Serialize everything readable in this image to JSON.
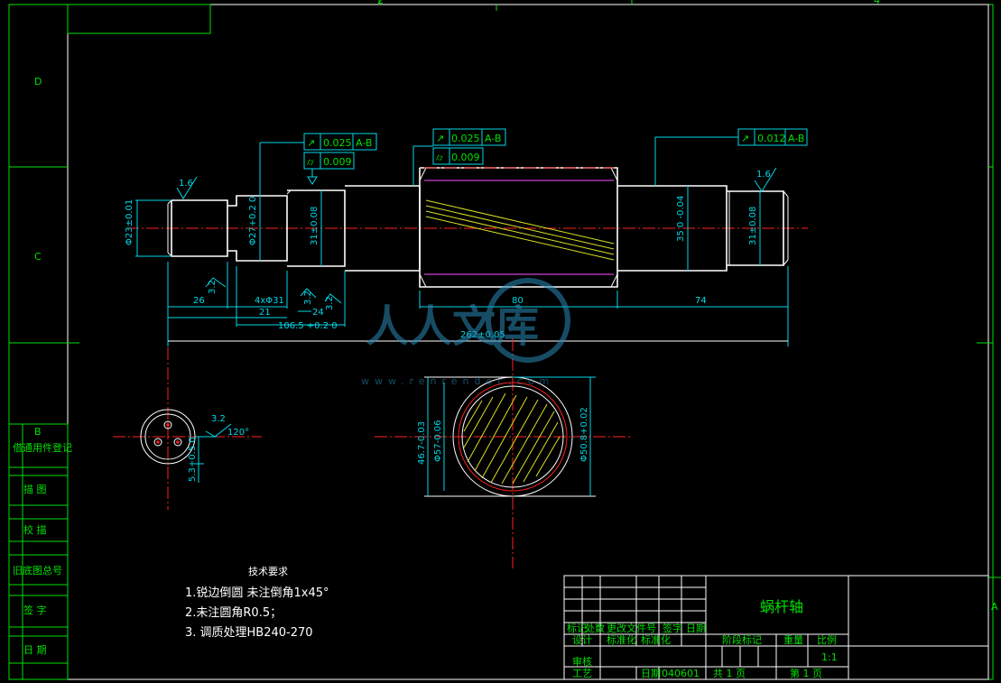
{
  "border": {
    "zone_letters": [
      "D",
      "C",
      "B",
      "A"
    ],
    "zone_numbers": [
      "2",
      "4"
    ]
  },
  "left_block": {
    "rows": [
      "借通用件登记",
      "描  图",
      "校  描",
      "旧底图总号",
      "签  字",
      "日  期"
    ]
  },
  "tolerances": {
    "left": [
      {
        "symbol": "↗",
        "value": "0.025",
        "datum": "A-B"
      },
      {
        "symbol": "⌭",
        "value": "0.009"
      }
    ],
    "middle": [
      {
        "symbol": "↗",
        "value": "0.025",
        "datum": "A-B"
      },
      {
        "symbol": "⌭",
        "value": "0.009"
      }
    ],
    "right": [
      {
        "symbol": "↗",
        "value": "0.012",
        "datum": "A-B"
      }
    ]
  },
  "roughness": {
    "r1": "1.6",
    "r2": "3.2",
    "r3": "3.2",
    "r4": "3.2",
    "r5": "1.6",
    "r6": "3.2"
  },
  "diameters": {
    "d1": "Φ23±0.01",
    "d2": "Φ27+0.2 0",
    "d3": "31±0.08",
    "d4": "35 0 -0.04",
    "d5": "31±0.08"
  },
  "lengths": {
    "l26": "26",
    "l_holes": "4xΦ31",
    "l21": "21",
    "l24": "24",
    "l106": "106.5 +0.2 0",
    "l80": "80",
    "l74": "74",
    "l262": "262±0.05"
  },
  "section_left": {
    "angle": "120°",
    "rough": "3.2",
    "dim": "5.3+0.5 0"
  },
  "section_right": {
    "d_a": "46.7-0.03",
    "d_b": "Φ57-0.06",
    "d_c": "Φ50.8+0.02"
  },
  "watermark": {
    "text": "人人文库",
    "url": "www.renrendoc.com"
  },
  "tech_requirements": {
    "title": "技术要求",
    "items": [
      "1.锐边倒圆  未注倒角1x45°",
      "2.未注圆角R0.5；",
      "3. 调质处理HB240-270"
    ]
  },
  "title_block": {
    "part_name": "蜗杆轴",
    "header_labels": [
      "标记",
      "处数",
      "更改文件号",
      "签字",
      "日期"
    ],
    "row_labels": [
      "设计",
      "标准化",
      "标准化"
    ],
    "review": "审核",
    "process": "工艺",
    "date_label": "日期",
    "date_value": "040601",
    "stage_label": "阶段标记",
    "weight_label": "重量",
    "scale_label": "比例",
    "scale_value": "1:1",
    "total_sheets": "共 1 页",
    "sheet_no": "第 1 页"
  }
}
